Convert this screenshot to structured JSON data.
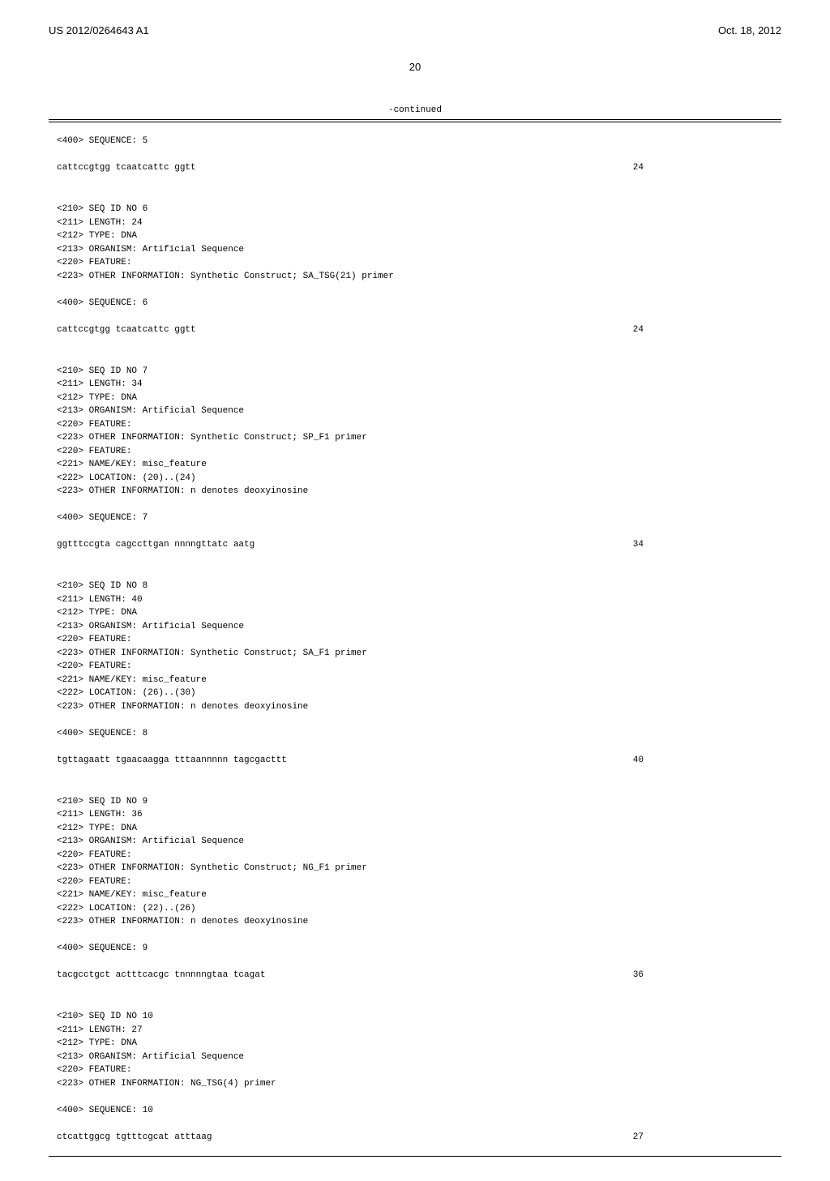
{
  "header": {
    "pub_number": "US 2012/0264643 A1",
    "pub_date": "Oct. 18, 2012"
  },
  "page_number": "20",
  "continued_label": "-continued",
  "sequences": [
    {
      "header_lines": [
        "<400> SEQUENCE: 5"
      ],
      "seq_text": "cattccgtgg tcaatcattc ggtt",
      "seq_length": "24"
    },
    {
      "header_lines": [
        "<210> SEQ ID NO 6",
        "<211> LENGTH: 24",
        "<212> TYPE: DNA",
        "<213> ORGANISM: Artificial Sequence",
        "<220> FEATURE:",
        "<223> OTHER INFORMATION: Synthetic Construct; SA_TSG(21) primer",
        "",
        "<400> SEQUENCE: 6"
      ],
      "seq_text": "cattccgtgg tcaatcattc ggtt",
      "seq_length": "24"
    },
    {
      "header_lines": [
        "<210> SEQ ID NO 7",
        "<211> LENGTH: 34",
        "<212> TYPE: DNA",
        "<213> ORGANISM: Artificial Sequence",
        "<220> FEATURE:",
        "<223> OTHER INFORMATION: Synthetic Construct; SP_F1 primer",
        "<220> FEATURE:",
        "<221> NAME/KEY: misc_feature",
        "<222> LOCATION: (20)..(24)",
        "<223> OTHER INFORMATION: n denotes deoxyinosine",
        "",
        "<400> SEQUENCE: 7"
      ],
      "seq_text": "ggtttccgta cagccttgan nnnngttatc aatg",
      "seq_length": "34"
    },
    {
      "header_lines": [
        "<210> SEQ ID NO 8",
        "<211> LENGTH: 40",
        "<212> TYPE: DNA",
        "<213> ORGANISM: Artificial Sequence",
        "<220> FEATURE:",
        "<223> OTHER INFORMATION: Synthetic Construct; SA_F1 primer",
        "<220> FEATURE:",
        "<221> NAME/KEY: misc_feature",
        "<222> LOCATION: (26)..(30)",
        "<223> OTHER INFORMATION: n denotes deoxyinosine",
        "",
        "<400> SEQUENCE: 8"
      ],
      "seq_text": "tgttagaatt tgaacaagga tttaannnnn tagcgacttt",
      "seq_length": "40"
    },
    {
      "header_lines": [
        "<210> SEQ ID NO 9",
        "<211> LENGTH: 36",
        "<212> TYPE: DNA",
        "<213> ORGANISM: Artificial Sequence",
        "<220> FEATURE:",
        "<223> OTHER INFORMATION: Synthetic Construct; NG_F1 primer",
        "<220> FEATURE:",
        "<221> NAME/KEY: misc_feature",
        "<222> LOCATION: (22)..(26)",
        "<223> OTHER INFORMATION: n denotes deoxyinosine",
        "",
        "<400> SEQUENCE: 9"
      ],
      "seq_text": "tacgcctgct actttcacgc tnnnnngtaa tcagat",
      "seq_length": "36"
    },
    {
      "header_lines": [
        "<210> SEQ ID NO 10",
        "<211> LENGTH: 27",
        "<212> TYPE: DNA",
        "<213> ORGANISM: Artificial Sequence",
        "<220> FEATURE:",
        "<223> OTHER INFORMATION: NG_TSG(4) primer",
        "",
        "<400> SEQUENCE: 10"
      ],
      "seq_text": "ctcattggcg tgtttcgcat atttaag",
      "seq_length": "27"
    }
  ]
}
